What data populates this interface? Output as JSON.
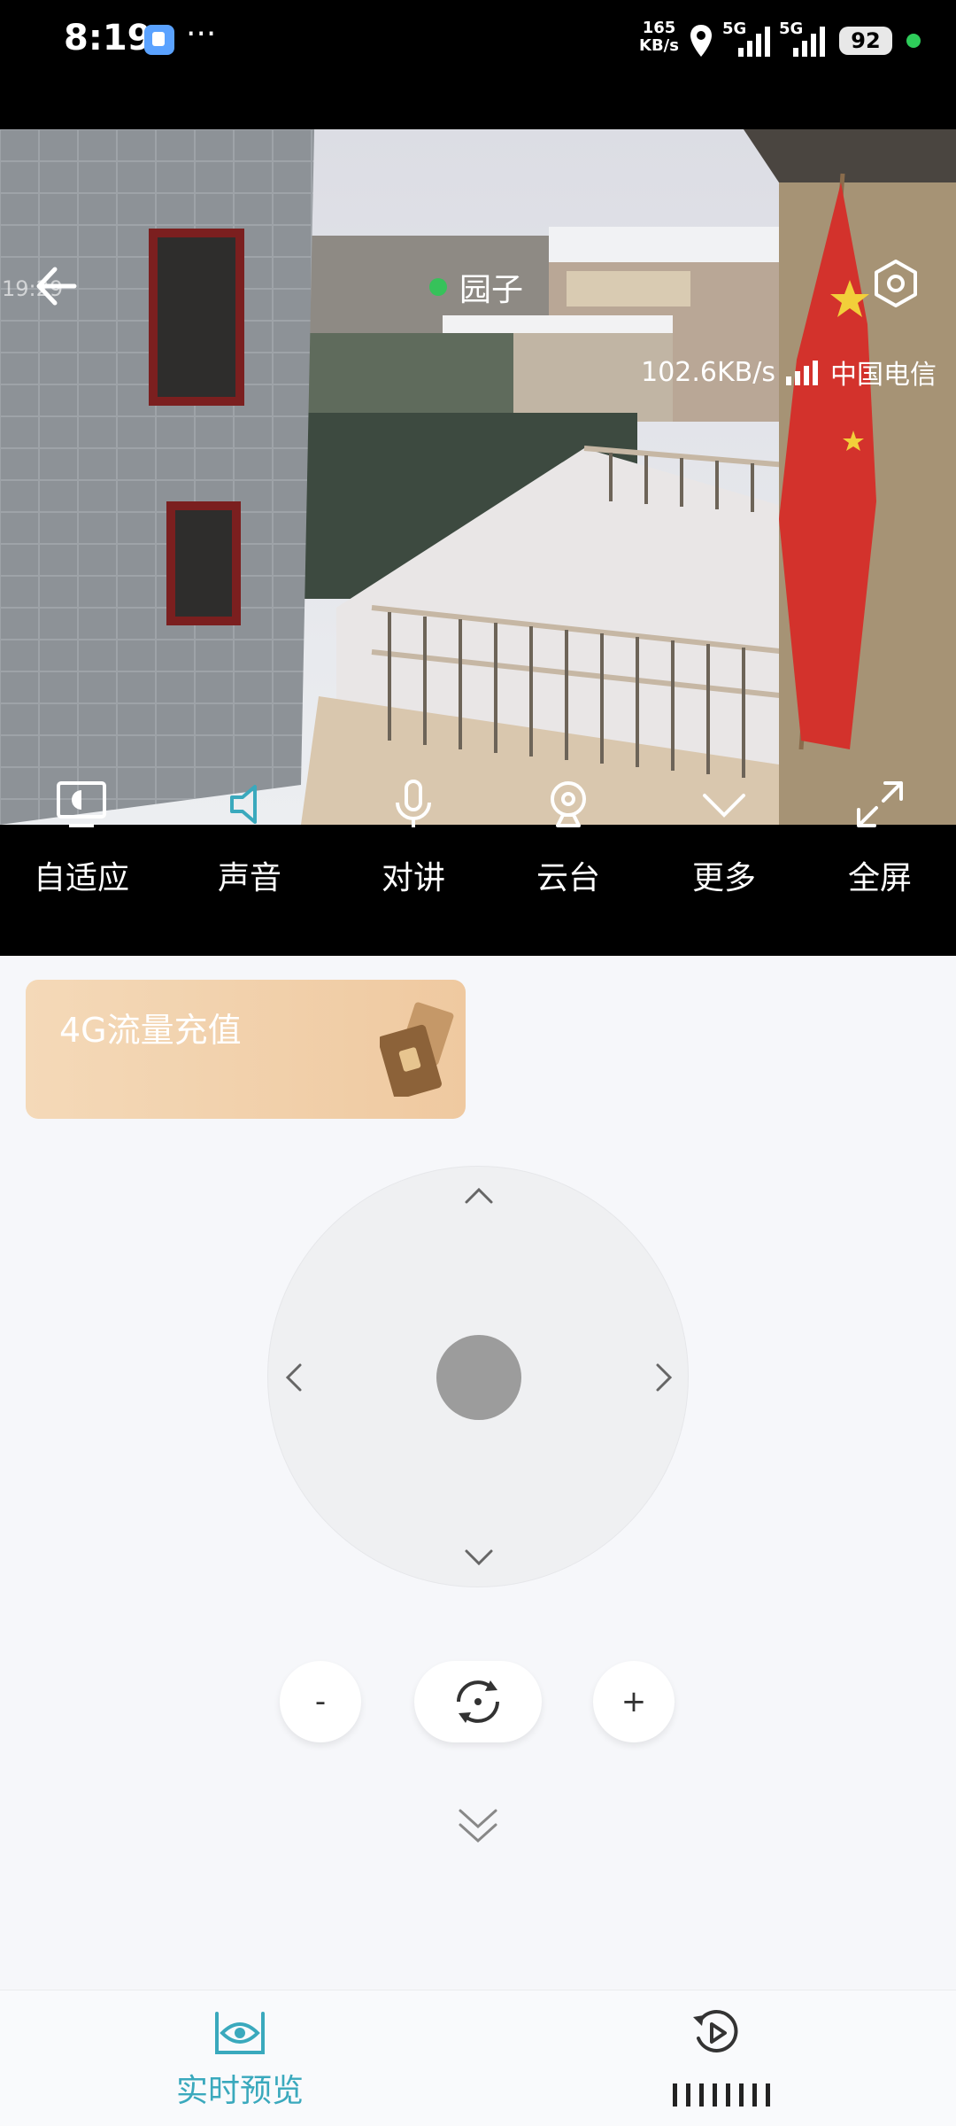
{
  "status_bar": {
    "time": "8:19",
    "dots": "···",
    "net_speed_value": "165",
    "net_speed_unit": "KB/s",
    "net_label_1": "5G",
    "net_label_2": "5G",
    "battery": "92",
    "icons": [
      "app-notification-icon",
      "location-icon",
      "signal-icon",
      "signal-icon",
      "battery-icon"
    ]
  },
  "video": {
    "timestamp": "19:29",
    "camera_name": "园子",
    "online_color": "#36c25a",
    "bitrate": "102.6KB/s",
    "carrier": "中国电信"
  },
  "controls": [
    {
      "id": "adaptive",
      "label": "自适应",
      "icon": "screen-adaptive-icon"
    },
    {
      "id": "sound",
      "label": "声音",
      "icon": "speaker-icon"
    },
    {
      "id": "talk",
      "label": "对讲",
      "icon": "microphone-icon"
    },
    {
      "id": "ptz",
      "label": "云台",
      "icon": "camera-ptz-icon"
    },
    {
      "id": "more",
      "label": "更多",
      "icon": "chevron-down-icon"
    },
    {
      "id": "fullscreen",
      "label": "全屏",
      "icon": "fullscreen-icon"
    }
  ],
  "promo": {
    "title": "4G流量充值"
  },
  "ptz": {
    "zoom_out": "-",
    "zoom_in": "+"
  },
  "tabs": [
    {
      "label": "实时预览",
      "icon": "eye-icon",
      "active": true
    },
    {
      "label": "",
      "icon": "playback-icon",
      "active": false
    }
  ],
  "accent": "#3aa9bd"
}
